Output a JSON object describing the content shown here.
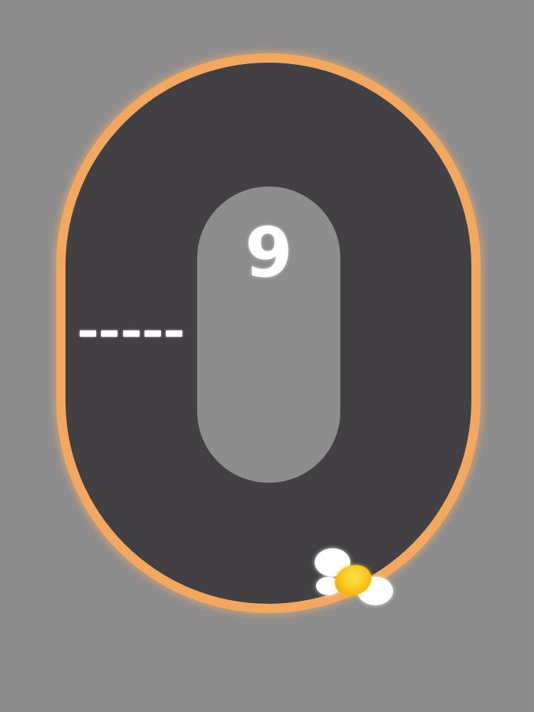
{
  "game": {
    "score": "9"
  },
  "colors": {
    "background": "#8e8d8e",
    "track": "#424042",
    "track_border": "#f2a860",
    "finish_line": "#ffffff",
    "player_ball": "#f7c01b",
    "player_trail": "#ffffff"
  },
  "icons": {
    "player": "yellow-ball-icon",
    "trail": "white-puff-icon"
  }
}
